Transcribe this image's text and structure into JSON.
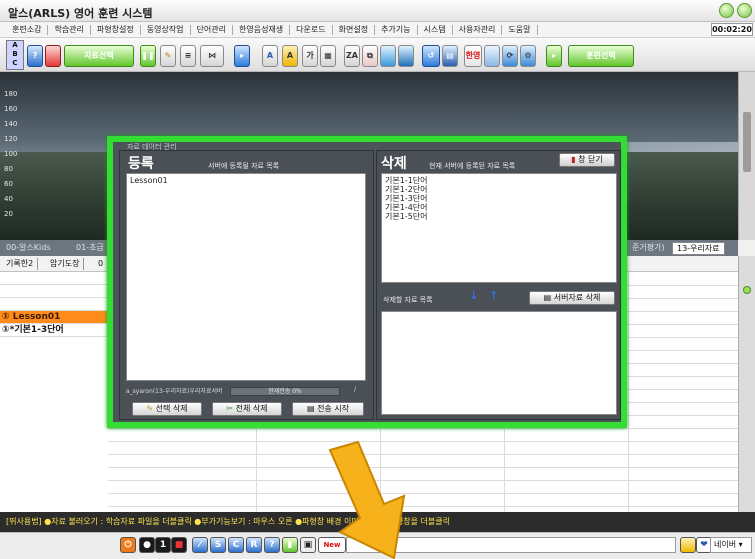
{
  "window": {
    "title": "알스(ARLS) 영어 훈련 시스템"
  },
  "menu": {
    "items": [
      "훈련소감",
      "학습관리",
      "파형창설정",
      "동영상작업",
      "단어관리",
      "한영음성재생",
      "다운로드",
      "화면설정",
      "추가기능",
      "시스템",
      "사용자관리",
      "도움말"
    ],
    "clock": "00:02:20"
  },
  "toolbar": {
    "abc": "A\nB\nC",
    "data_select": "자료선택",
    "training_select": "훈련선택",
    "btn_a_small": "A",
    "btn_a_big": "A",
    "btn_ga": "가",
    "btn_han": "한영"
  },
  "chart": {
    "yticks": [
      "180",
      "160",
      "140",
      "120",
      "100",
      "80",
      "60",
      "40",
      "20"
    ]
  },
  "tabs": {
    "left": "00-알스Kids",
    "left2": "01-초급",
    "right_partial": "준거평가)",
    "active": "13-우리자료"
  },
  "subtabs": [
    "기록한2",
    "암기도장",
    "0"
  ],
  "list": {
    "items": [
      "① Lesson01",
      "①*기본1-3단어"
    ]
  },
  "modal": {
    "header_small": "자료 데이터 관리",
    "left": {
      "title": "등록",
      "note": "서버에 등록될 자료 목록",
      "items": [
        "Lesson01"
      ],
      "path": "a_syaron(13-우리자료)우리자료서버",
      "progress_label": "현재전송 0%",
      "progress_value": 0,
      "slash": "/",
      "btn_select_delete": "선택 삭제",
      "btn_all_delete": "전체 삭제",
      "btn_send": "전송 시작"
    },
    "right": {
      "title": "삭제",
      "note": "현재 서버에 등록된 자료 목록",
      "close": "창 닫기",
      "items": [
        "기본1-1단어",
        "기본1-2단어",
        "기본1-3단어",
        "기본1-4단어",
        "기본1-5단어"
      ],
      "delete_list_label": "삭제할 자료 목록",
      "btn_server_delete": "서버자료 삭제",
      "arrow_down": "↓",
      "arrow_up": "↑"
    }
  },
  "help": {
    "text": "[뛰사용법] ●자료 불러오기 : 학습자료 파일을 더블클릭      ●부가기능보기 : 마우스 오른       ●파형창 배경 이미지변경 : 파형창을 더블클릭"
  },
  "bottom": {
    "btn_1": "1",
    "btn_s": "S",
    "btn_c": "C",
    "btn_r": "R",
    "btn_q": "?",
    "btn_new": "New",
    "naver": "네이버"
  },
  "colors": {
    "modal_border": "#33dd33",
    "accent_orange": "#ff8c1a",
    "arrow": "#f7b21b"
  }
}
